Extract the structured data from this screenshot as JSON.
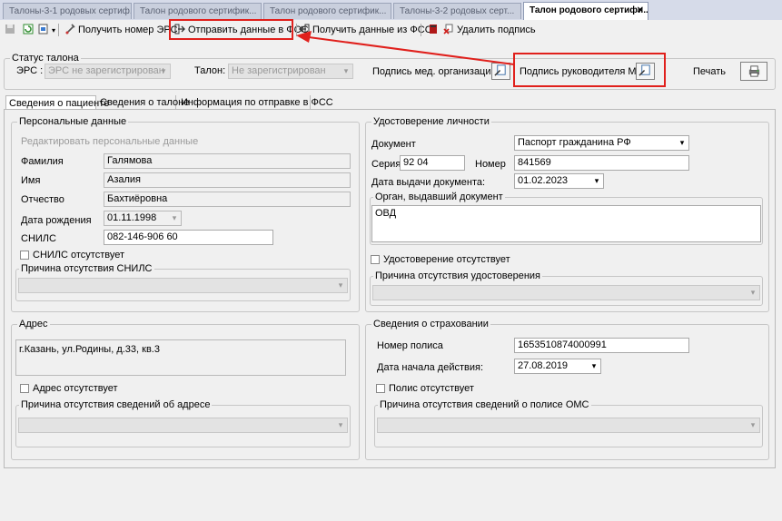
{
  "doc_tabs": [
    {
      "label": "Талоны-3-1 родовых сертиф..."
    },
    {
      "label": "Талон родового сертифик..."
    },
    {
      "label": "Талон родового сертифик..."
    },
    {
      "label": "Талоны-3-2 родовых серт..."
    },
    {
      "label": "Талон родового сертифи..."
    }
  ],
  "toolbar": {
    "get_ers_number": "Получить номер ЭРС",
    "send_fss": "Отправить данные в ФСС",
    "get_fss": "Получить данные из ФСС",
    "delete_signature": "Удалить подпись"
  },
  "status": {
    "title": "Статус талона",
    "ers_label": "ЭРС :",
    "ers_value": "ЭРС не зарегистрирован",
    "talon_label": "Талон:",
    "talon_value": "Не зарегистрирован",
    "sign_org": "Подпись мед. организации",
    "sign_head": "Подпись руководителя МО",
    "print": "Печать"
  },
  "tabs": [
    "Сведения о пациенте",
    "Сведения о талоне",
    "Информация по отправке в ФСС"
  ],
  "personal": {
    "title": "Персональные данные",
    "edit_link": "Редактировать персональные данные",
    "surname_label": "Фамилия",
    "surname": "Галямова",
    "name_label": "Имя",
    "name": "Азалия",
    "patronymic_label": "Отчество",
    "patronymic": "Бахтиёровна",
    "dob_label": "Дата рождения",
    "dob": "01.11.1998",
    "snils_label": "СНИЛС",
    "snils": "082-146-906 60",
    "snils_absent": "СНИЛС отсутствует",
    "snils_reason": "Причина отсутствия СНИЛС"
  },
  "identity": {
    "title": "Удостоверение личности",
    "doc_label": "Документ",
    "doc": "Паспорт гражданина РФ",
    "series_label": "Серия",
    "series": "92 04",
    "number_label": "Номер",
    "number": "841569",
    "issue_date_label": "Дата выдачи документа:",
    "issue_date": "01.02.2023",
    "issuer_label": "Орган, выдавший документ",
    "issuer": "ОВД",
    "absent": "Удостоверение отсутствует",
    "reason": "Причина отсутствия удостоверения"
  },
  "address": {
    "title": "Адрес",
    "value": "г.Казань, ул.Родины, д.33, кв.3",
    "absent": "Адрес отсутствует",
    "reason": "Причина отсутствия сведений об адресе"
  },
  "insurance": {
    "title": "Сведения о страховании",
    "policy_label": "Номер полиса",
    "policy": "1653510874000991",
    "start_label": "Дата начала действия:",
    "start": "27.08.2019",
    "absent": "Полис отсутствует",
    "reason": "Причина отсутствия сведений о полисе ОМС"
  },
  "colors": {
    "highlight": "#e0201c"
  }
}
